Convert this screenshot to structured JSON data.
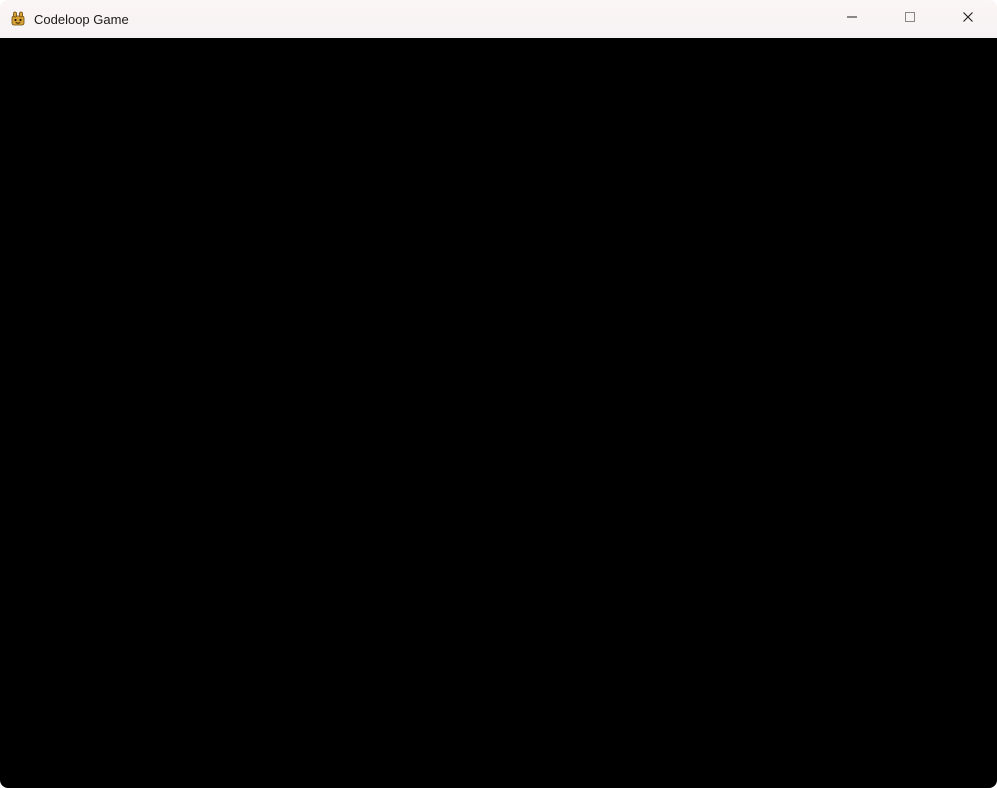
{
  "window": {
    "title": "Codeloop Game",
    "icon_name": "app-icon",
    "controls": {
      "minimize": "minimize",
      "maximize": "maximize",
      "close": "close"
    }
  },
  "client": {
    "background_color": "#000000"
  }
}
